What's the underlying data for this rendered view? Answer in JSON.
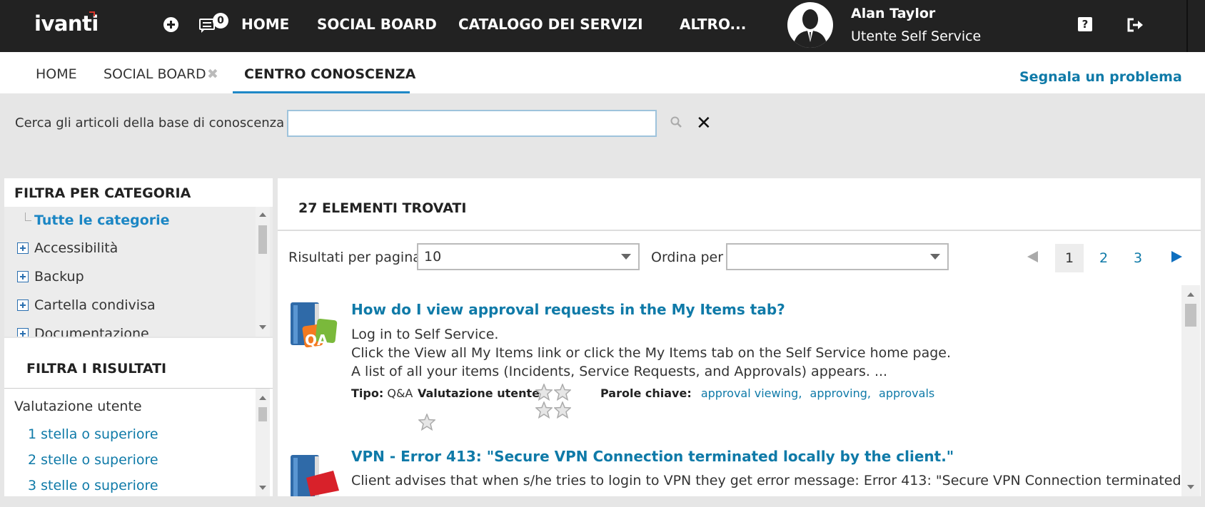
{
  "brand": {
    "logo": "ivanti"
  },
  "topbar": {
    "chat_count": "0",
    "nav": [
      "HOME",
      "SOCIAL BOARD",
      "CATALOGO DEI SERVIZI",
      "ALTRO..."
    ],
    "user_name": "Alan Taylor",
    "user_role": "Utente Self Service",
    "help_glyph": "?"
  },
  "tabs": {
    "items": [
      "HOME",
      "SOCIAL BOARD",
      "CENTRO CONOSCENZA"
    ],
    "close_glyph": "✖",
    "report_link": "Segnala un problema"
  },
  "search": {
    "label": "Cerca gli articoli della base di conoscenza",
    "value": "",
    "clear_glyph": "✕"
  },
  "category_filter": {
    "heading": "FILTRA PER CATEGORIA",
    "all": "Tutte le categorie",
    "items": [
      "Accessibilità",
      "Backup",
      "Cartella condivisa",
      "Documentazione"
    ]
  },
  "result_filter": {
    "heading": "FILTRA I RISULTATI",
    "group": "Valutazione utente",
    "items": [
      "1 stella o superiore",
      "2 stelle o superiore",
      "3 stelle o superiore"
    ]
  },
  "results": {
    "count_heading": "27 ELEMENTI TROVATI",
    "per_page_label": "Risultati per pagina",
    "per_page_value": "10",
    "sort_label": "Ordina per",
    "sort_value": "",
    "pages": [
      "1",
      "2",
      "3"
    ],
    "current_page": "1"
  },
  "articles": [
    {
      "title": "How do I view approval requests in the My Items tab?",
      "lines": [
        "Log in to Self Service.",
        "Click the View all My Items link or click the My Items tab on the Self Service home page.",
        "A list of all your items (Incidents, Service Requests, and Approvals) appears. ..."
      ],
      "type_label": "Tipo:",
      "type_value": "Q&A",
      "rating_label": "Valutazione utente:",
      "keywords_label": "Parole chiave:",
      "keywords": [
        "approval viewing,",
        "approving,",
        "approvals"
      ],
      "icon_text": "QA"
    },
    {
      "title": "VPN - Error 413: \"Secure VPN Connection terminated locally by the client.\"",
      "lines": [
        "Client advises that when s/he tries to login to VPN they get error message: Error 413: \"Secure VPN Connection terminated"
      ]
    }
  ],
  "colors": {
    "accent": "#0f7aa8",
    "topbar": "#222222",
    "tab_underline": "#1e88c7"
  }
}
